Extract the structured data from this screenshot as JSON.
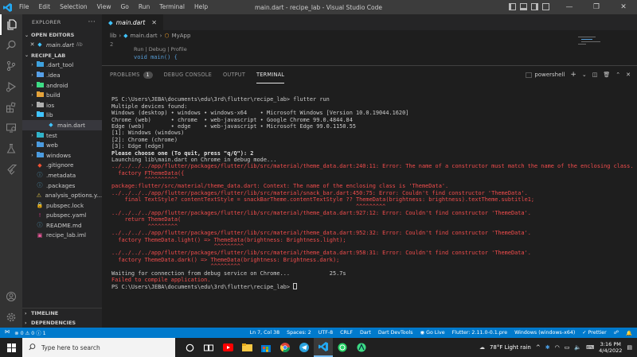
{
  "window": {
    "title": "main.dart - recipe_lab - Visual Studio Code",
    "menu": [
      "File",
      "Edit",
      "Selection",
      "View",
      "Go",
      "Run",
      "Terminal",
      "Help"
    ]
  },
  "sidebar": {
    "header": "EXPLORER",
    "open_editors": "OPEN EDITORS",
    "open_file": "main.dart",
    "open_file_hint": "lib",
    "project": "RECIPE_LAB",
    "items": [
      {
        "label": ".dart_tool",
        "type": "folder"
      },
      {
        "label": ".idea",
        "type": "folder"
      },
      {
        "label": "android",
        "type": "folder"
      },
      {
        "label": "build",
        "type": "folder"
      },
      {
        "label": "ios",
        "type": "folder"
      },
      {
        "label": "lib",
        "type": "folder-open"
      },
      {
        "label": "main.dart",
        "type": "dart"
      },
      {
        "label": "test",
        "type": "folder"
      },
      {
        "label": "web",
        "type": "folder"
      },
      {
        "label": "windows",
        "type": "folder"
      },
      {
        "label": ".gitignore",
        "type": "git"
      },
      {
        "label": ".metadata",
        "type": "info"
      },
      {
        "label": ".packages",
        "type": "info"
      },
      {
        "label": "analysis_options.y...",
        "type": "warn"
      },
      {
        "label": "pubspec.lock",
        "type": "lock"
      },
      {
        "label": "pubspec.yaml",
        "type": "yaml"
      },
      {
        "label": "README.md",
        "type": "info"
      },
      {
        "label": "recipe_lab.iml",
        "type": "iml"
      }
    ],
    "timeline": "TIMELINE",
    "dependencies": "DEPENDENCIES"
  },
  "editor": {
    "tab": "main.dart",
    "breadcrumb": [
      "lib",
      "main.dart",
      "MyApp"
    ],
    "line_number": "2",
    "codelens": "Run | Debug | Profile",
    "code_line": "void main() {"
  },
  "panel": {
    "tabs": [
      "PROBLEMS",
      "DEBUG CONSOLE",
      "OUTPUT",
      "TERMINAL"
    ],
    "problems_count": "1",
    "terminal_name": "powershell",
    "lines": [
      {
        "t": "",
        "k": "blank"
      },
      {
        "t": "PS C:\\Users\\JEBA\\documents\\edu\\3rd\\flutter\\recipe_lab> flutter run",
        "k": "normal"
      },
      {
        "t": "Multiple devices found:",
        "k": "normal"
      },
      {
        "t": "Windows (desktop) • windows • windows-x64    • Microsoft Windows [Version 10.0.19044.1620]",
        "k": "normal"
      },
      {
        "t": "Chrome (web)      • chrome  • web-javascript • Google Chrome 99.0.4844.84",
        "k": "normal"
      },
      {
        "t": "Edge (web)        • edge    • web-javascript • Microsoft Edge 99.0.1150.55",
        "k": "normal"
      },
      {
        "t": "[1]: Windows (windows)",
        "k": "normal"
      },
      {
        "t": "[2]: Chrome (chrome)",
        "k": "normal"
      },
      {
        "t": "[3]: Edge (edge)",
        "k": "normal"
      },
      {
        "t": "Please choose one (To quit, press \"q/Q\"): 2",
        "k": "bold"
      },
      {
        "t": "Launching lib\\main.dart on Chrome in debug mode...",
        "k": "normal"
      },
      {
        "t": "../../../../app/flutter/packages/flutter/lib/src/material/theme_data.dart:240:11: Error: The name of a constructor must match the name of the enclosing class.",
        "k": "err"
      },
      {
        "t": "  factory FThemeData({",
        "k": "err"
      },
      {
        "t": "          ^^^^^^^^^^",
        "k": "err"
      },
      {
        "t": "package:flutter/src/material/theme_data.dart: Context: The name of the enclosing class is 'ThemeData'.",
        "k": "err"
      },
      {
        "t": "../../../../app/flutter/packages/flutter/lib/src/material/snack_bar.dart:450:75: Error: Couldn't find constructor 'ThemeData'.",
        "k": "err"
      },
      {
        "t": "    final TextStyle? contentTextStyle = snackBarTheme.contentTextStyle ?? ThemeData(brightness: brightness).textTheme.subtitle1;",
        "k": "err"
      },
      {
        "t": "                                                                          ^^^^^^^^^",
        "k": "err"
      },
      {
        "t": "../../../../app/flutter/packages/flutter/lib/src/material/theme_data.dart:927:12: Error: Couldn't find constructor 'ThemeData'.",
        "k": "err"
      },
      {
        "t": "    return ThemeData(",
        "k": "err"
      },
      {
        "t": "           ^^^^^^^^^",
        "k": "err"
      },
      {
        "t": "../../../../app/flutter/packages/flutter/lib/src/material/theme_data.dart:952:32: Error: Couldn't find constructor 'ThemeData'.",
        "k": "err"
      },
      {
        "t": "  factory ThemeData.light() => ThemeData(brightness: Brightness.light);",
        "k": "err"
      },
      {
        "t": "                               ^^^^^^^^^",
        "k": "err"
      },
      {
        "t": "../../../../app/flutter/packages/flutter/lib/src/material/theme_data.dart:958:31: Error: Couldn't find constructor 'ThemeData'.",
        "k": "err"
      },
      {
        "t": "  factory ThemeData.dark() => ThemeData(brightness: Brightness.dark);",
        "k": "err"
      },
      {
        "t": "                              ^^^^^^^^^",
        "k": "err"
      },
      {
        "t": "Waiting for connection from debug service on Chrome...            25.7s",
        "k": "normal"
      },
      {
        "t": "Failed to compile application.",
        "k": "err"
      },
      {
        "t": "PS C:\\Users\\JEBA\\documents\\edu\\3rd\\flutter\\recipe_lab> ",
        "k": "prompt"
      }
    ]
  },
  "status": {
    "errors": "0",
    "warnings": "0",
    "info": "1",
    "position": "Ln 7, Col 38",
    "spaces": "Spaces: 2",
    "encoding": "UTF-8",
    "eol": "CRLF",
    "language": "Dart",
    "devtools": "Dart DevTools",
    "golive": "Go Live",
    "flutter": "Flutter: 2.11.0-0.1.pre",
    "device": "Windows (windows-x64)",
    "prettier": "Prettier"
  },
  "taskbar": {
    "search_placeholder": "Type here to search",
    "weather": "78°F  Light rain",
    "time": "3:16 PM",
    "date": "4/4/2022"
  },
  "colors": {
    "accent": "#007acc",
    "error": "#f14c4c",
    "dart": "#40c4ff"
  }
}
